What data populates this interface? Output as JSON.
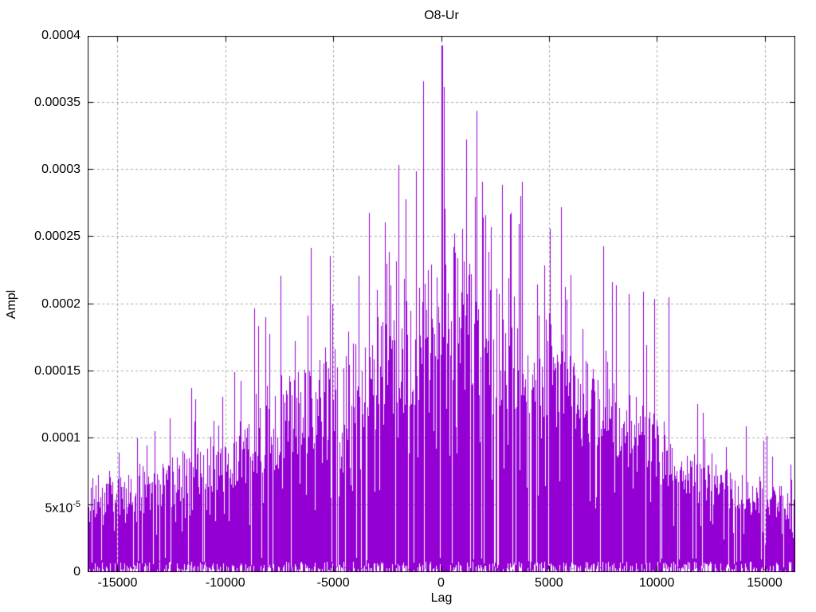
{
  "window": {
    "background": "#ffffff"
  },
  "chart_data": {
    "type": "impulse",
    "title": "O8-Ur",
    "xlabel": "Lag",
    "ylabel": "Ampl",
    "xlim": [
      -16384,
      16384
    ],
    "ylim": [
      0,
      0.0004
    ],
    "x_ticks": [
      {
        "v": -15000,
        "label": "-15000"
      },
      {
        "v": -10000,
        "label": "-10000"
      },
      {
        "v": -5000,
        "label": "-5000"
      },
      {
        "v": 0,
        "label": "0"
      },
      {
        "v": 5000,
        "label": "5000"
      },
      {
        "v": 10000,
        "label": "10000"
      },
      {
        "v": 15000,
        "label": "15000"
      }
    ],
    "y_ticks": [
      {
        "v": 0.0,
        "label": "0"
      },
      {
        "v": 5e-05,
        "label": "5x10^-5"
      },
      {
        "v": 0.0001,
        "label": "0.0001"
      },
      {
        "v": 0.00015,
        "label": "0.00015"
      },
      {
        "v": 0.0002,
        "label": "0.0002"
      },
      {
        "v": 0.00025,
        "label": "0.00025"
      },
      {
        "v": 0.0003,
        "label": "0.0003"
      },
      {
        "v": 0.00035,
        "label": "0.00035"
      },
      {
        "v": 0.0004,
        "label": "0.0004"
      }
    ],
    "grid": {
      "visible": true,
      "style": "dashed",
      "color": "#a9a9a9"
    },
    "series_color": "#9400D3",
    "border_color": "#000000",
    "envelope": [
      [
        -16384,
        4.8e-05,
        8e-05
      ],
      [
        -16000,
        5e-05,
        9e-05
      ],
      [
        -15000,
        5.4e-05,
        0.0001
      ],
      [
        -14000,
        5.8e-05,
        0.000118
      ],
      [
        -13000,
        6.2e-05,
        0.00013
      ],
      [
        -12000,
        6.8e-05,
        0.00014
      ],
      [
        -11000,
        7.4e-05,
        0.000152
      ],
      [
        -10000,
        8.2e-05,
        0.00016
      ],
      [
        -9000,
        9e-05,
        0.000188
      ],
      [
        -8000,
        0.0001,
        0.000205
      ],
      [
        -7000,
        0.00011,
        0.000225
      ],
      [
        -6000,
        0.00012,
        0.000238
      ],
      [
        -5000,
        0.000128,
        0.000235
      ],
      [
        -4000,
        0.000133,
        0.000248
      ],
      [
        -3000,
        0.000142,
        0.000262
      ],
      [
        -2000,
        0.000153,
        0.00029
      ],
      [
        -1000,
        0.000168,
        0.000305
      ],
      [
        0,
        0.000188,
        0.000318
      ],
      [
        1000,
        0.000181,
        0.000318
      ],
      [
        2000,
        0.000173,
        0.000305
      ],
      [
        3000,
        0.000164,
        0.000285
      ],
      [
        4000,
        0.000154,
        0.000282
      ],
      [
        5000,
        0.000145,
        0.000262
      ],
      [
        6000,
        0.000132,
        0.000262
      ],
      [
        7000,
        0.000118,
        0.000242
      ],
      [
        8000,
        0.000111,
        0.000215
      ],
      [
        9000,
        0.000102,
        0.000208
      ],
      [
        10000,
        9e-05,
        0.000198
      ],
      [
        11000,
        7.7e-05,
        0.000158
      ],
      [
        12000,
        6.7e-05,
        0.000145
      ],
      [
        13000,
        6.1e-05,
        0.00013
      ],
      [
        14000,
        5.6e-05,
        0.000116
      ],
      [
        15000,
        5.2e-05,
        0.000103
      ],
      [
        16000,
        4.9e-05,
        8.8e-05
      ],
      [
        16384,
        4.8e-05,
        8.2e-05
      ]
    ],
    "peaks": [
      [
        0,
        0.000393
      ],
      [
        -830,
        0.000366
      ],
      [
        130,
        0.000362
      ],
      [
        1640,
        0.000344
      ],
      [
        1150,
        0.000323
      ],
      [
        -1960,
        0.000304
      ],
      [
        -1180,
        0.000299
      ],
      [
        1900,
        0.000291
      ],
      [
        3760,
        0.000291
      ],
      [
        2840,
        0.000289
      ],
      [
        5550,
        0.000272
      ],
      [
        -3340,
        0.000268
      ],
      [
        -2600,
        0.000261
      ],
      [
        5050,
        0.000256
      ],
      [
        7500,
        0.000243
      ],
      [
        -6030,
        0.000242
      ],
      [
        -5150,
        0.000236
      ],
      [
        -7440,
        0.000221
      ],
      [
        8100,
        0.000214
      ],
      [
        9380,
        0.000209
      ],
      [
        9900,
        0.000204
      ],
      [
        -8680,
        0.000197
      ],
      [
        -8150,
        0.00019
      ],
      [
        10550,
        0.000205
      ]
    ]
  }
}
